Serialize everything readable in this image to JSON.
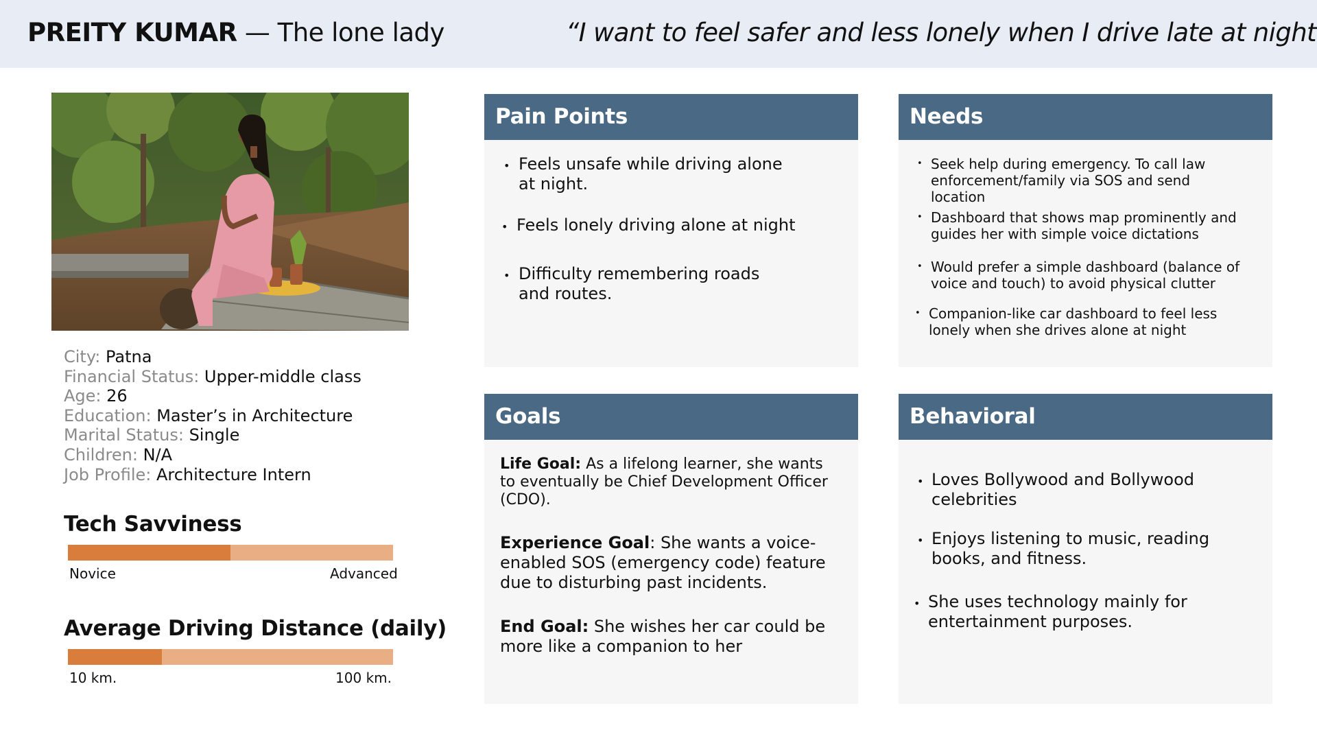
{
  "header": {
    "name": "PREITY KUMAR",
    "tagline": " — The lone lady",
    "quote": "“I want to feel safer and less lonely when I drive late at night.”"
  },
  "profile": [
    {
      "label": "City: ",
      "value": "Patna"
    },
    {
      "label": "Financial Status: ",
      "value": "Upper-middle class"
    },
    {
      "label": "Age: ",
      "value": "26"
    },
    {
      "label": "Education: ",
      "value": "Master’s in Architecture"
    },
    {
      "label": "Marital Status: ",
      "value": "Single"
    },
    {
      "label": "Children: ",
      "value": "N/A"
    },
    {
      "label": "Job Profile: ",
      "value": "Architecture Intern"
    }
  ],
  "tech_savviness": {
    "title": "Tech Savviness",
    "min_label": "Novice",
    "max_label": "Advanced",
    "level": 0.5,
    "fill_color": "#d97d3d",
    "track_color": "#e9ae84"
  },
  "driving_distance": {
    "title": "Average Driving Distance (daily)",
    "min_label": "10 km.",
    "max_label": "100 km.",
    "level": 0.29,
    "fill_color": "#d97d3d",
    "track_color": "#e9ae84"
  },
  "pain_points": {
    "title": "Pain Points",
    "items": [
      "Feels unsafe while driving alone at night.",
      "Feels lonely driving alone at night",
      "Difficulty remembering roads and routes."
    ]
  },
  "needs": {
    "title": "Needs",
    "items": [
      "Seek help during  emergency. To call law enforcement/family via SOS and send location",
      "Dashboard that shows map prominently and guides her with simple voice dictations",
      "Would prefer a simple dashboard (balance of voice and touch) to avoid physical clutter",
      "Companion-like car dashboard to feel less lonely when she drives alone at night"
    ]
  },
  "goals": {
    "title": "Goals",
    "items": [
      {
        "label": "Life Goal:",
        "text": " As a lifelong learner, she wants to eventually be Chief Development Officer (CDO)."
      },
      {
        "label": "Experience Goal",
        "text": ": She wants a voice-enabled SOS (emergency code) feature due to disturbing  past incidents."
      },
      {
        "label": "End Goal:",
        "text": " She wishes her car could be more like a companion to her"
      }
    ]
  },
  "behavioral": {
    "title": "Behavioral",
    "items": [
      "Loves Bollywood and Bollywood celebrities",
      "Enjoys listening to music, reading books, and fitness.",
      "She uses technology mainly for entertainment purposes."
    ]
  },
  "colors": {
    "header_bg": "#e8ecf4",
    "card_header": "#4a6984",
    "card_body": "#f6f6f6"
  },
  "bullet_char": "•"
}
